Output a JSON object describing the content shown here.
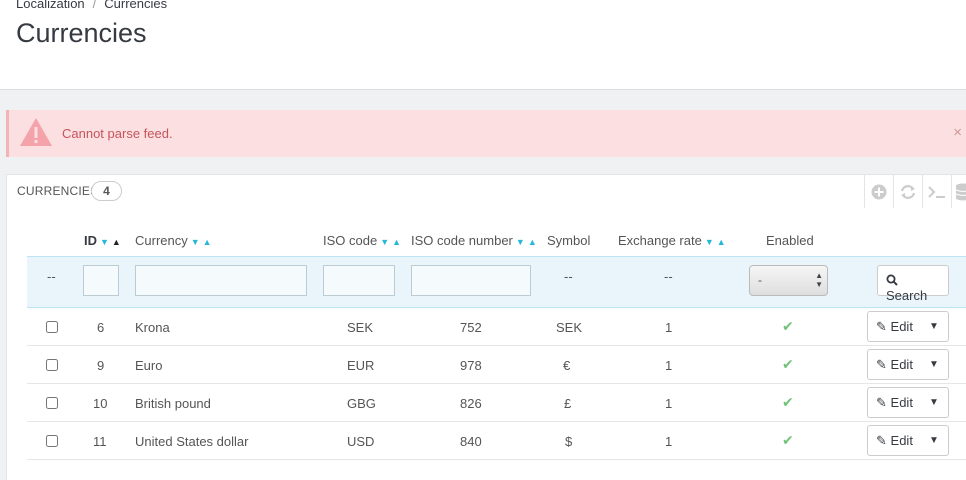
{
  "breadcrumb": {
    "parent": "Localization",
    "separator": "/",
    "current": "Currencies"
  },
  "page": {
    "title": "Currencies"
  },
  "alert": {
    "message": "Cannot parse feed.",
    "close": "×"
  },
  "panel": {
    "title": "CURRENCIES",
    "count": "4"
  },
  "toolbar": {
    "icons": [
      "add-icon",
      "refresh-icon",
      "sql-query-icon",
      "database-icon"
    ]
  },
  "columns": {
    "id": "ID",
    "currency": "Currency",
    "iso_code": "ISO code",
    "iso_code_number": "ISO code number",
    "symbol": "Symbol",
    "exchange_rate": "Exchange rate",
    "enabled": "Enabled"
  },
  "filters": {
    "dash": "--",
    "enabled_select_value": "-",
    "search_label": "Search"
  },
  "rows": [
    {
      "id": "6",
      "currency": "Krona",
      "iso_code": "SEK",
      "iso_number": "752",
      "symbol": "SEK",
      "rate": "1",
      "enabled": true
    },
    {
      "id": "9",
      "currency": "Euro",
      "iso_code": "EUR",
      "iso_number": "978",
      "symbol": "€",
      "rate": "1",
      "enabled": true
    },
    {
      "id": "10",
      "currency": "British pound",
      "iso_code": "GBG",
      "iso_number": "826",
      "symbol": "£",
      "rate": "1",
      "enabled": true
    },
    {
      "id": "11",
      "currency": "United States dollar",
      "iso_code": "USD",
      "iso_number": "840",
      "symbol": "$",
      "rate": "1",
      "enabled": true
    }
  ],
  "row_action": {
    "edit_label": "Edit"
  },
  "colors": {
    "accent": "#25b9d7",
    "alert_bg": "#fbdfe1",
    "alert_text": "#c7545c",
    "enabled_check": "#72c279"
  }
}
